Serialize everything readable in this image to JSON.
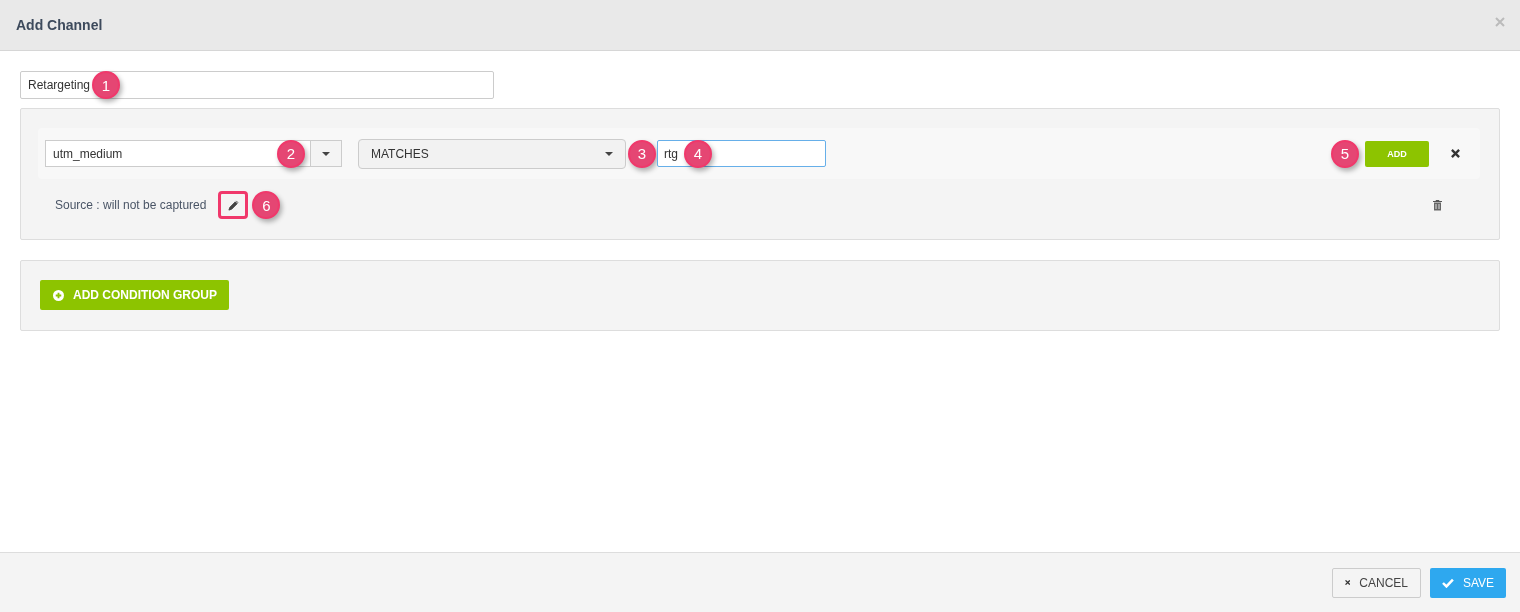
{
  "window": {
    "title": "Add Channel"
  },
  "name_field": {
    "value": "Retargeting"
  },
  "condition": {
    "field": "utm_medium",
    "operator": "MATCHES",
    "value": "rtg",
    "add_button": "ADD"
  },
  "source": {
    "text": "Source : will not be captured",
    "edit_highlighted": true
  },
  "add_group_button": "ADD CONDITION GROUP",
  "footer": {
    "cancel": "CANCEL",
    "save": "SAVE"
  },
  "callouts": [
    "1",
    "2",
    "3",
    "4",
    "5",
    "6"
  ]
}
